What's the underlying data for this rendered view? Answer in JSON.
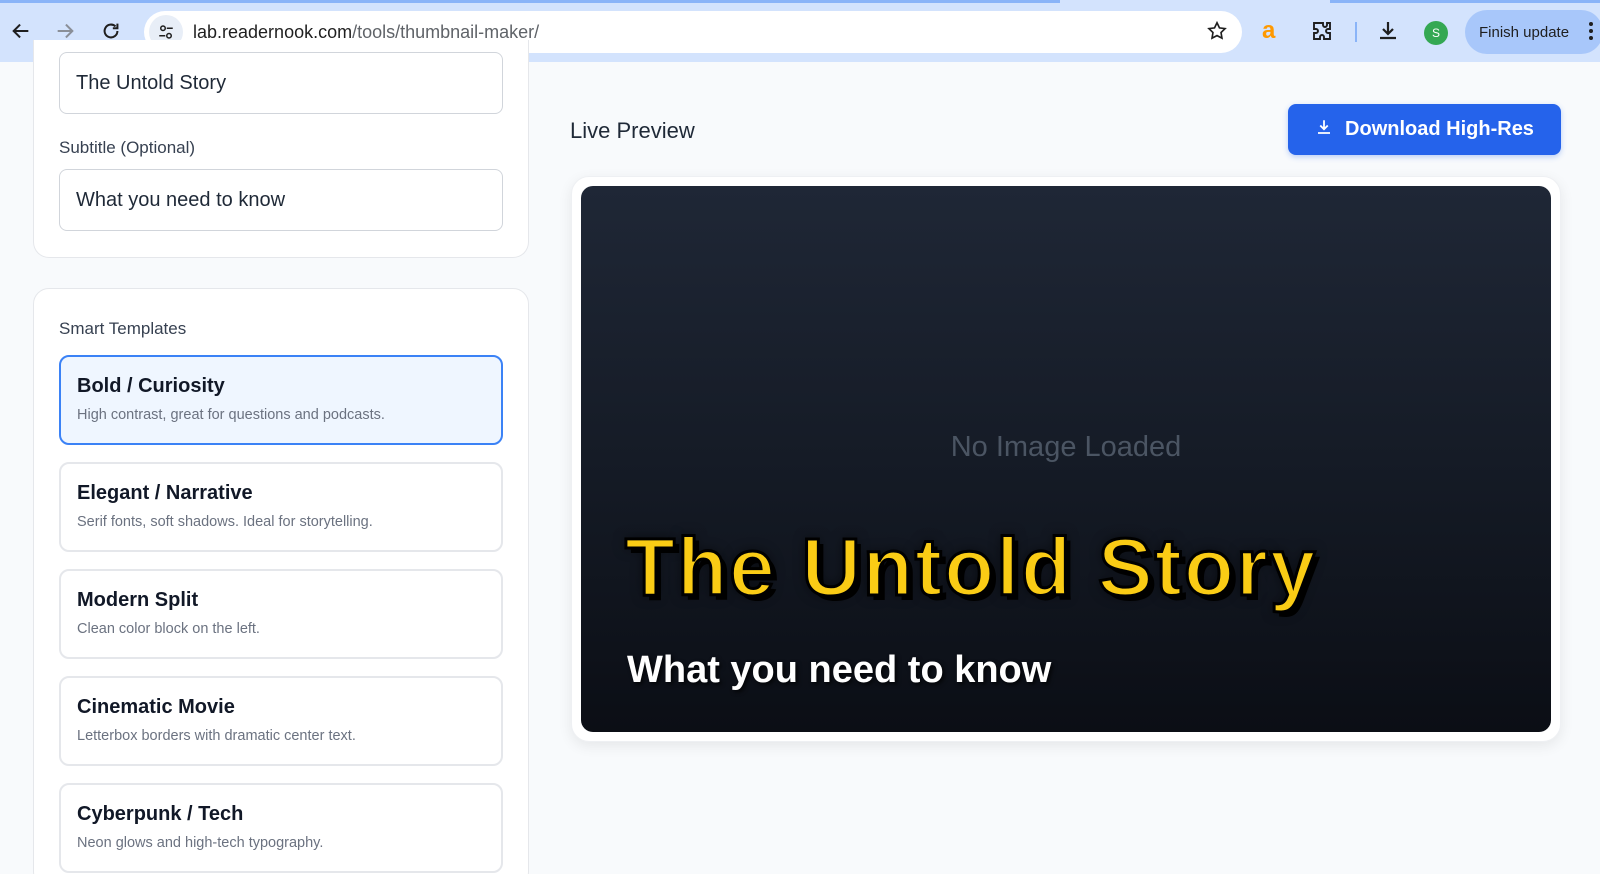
{
  "browser": {
    "url_host": "lab.readernook.com",
    "url_path": "/tools/thumbnail-maker/",
    "avatar_letter": "S",
    "finish_update_label": "Finish update",
    "extension_letter": "a"
  },
  "form": {
    "title_value": "The Untold Story",
    "subtitle_label": "Subtitle (Optional)",
    "subtitle_value": "What you need to know"
  },
  "templates": {
    "heading": "Smart Templates",
    "items": [
      {
        "title": "Bold / Curiosity",
        "desc": "High contrast, great for questions and podcasts."
      },
      {
        "title": "Elegant / Narrative",
        "desc": "Serif fonts, soft shadows. Ideal for storytelling."
      },
      {
        "title": "Modern Split",
        "desc": "Clean color block on the left."
      },
      {
        "title": "Cinematic Movie",
        "desc": "Letterbox borders with dramatic center text."
      },
      {
        "title": "Cyberpunk / Tech",
        "desc": "Neon glows and high-tech typography."
      }
    ]
  },
  "preview": {
    "heading": "Live Preview",
    "download_label": "Download High-Res",
    "no_image_text": "No Image Loaded",
    "thumb_title": "The Untold Story",
    "thumb_subtitle": "What you need to know"
  },
  "colors": {
    "accent": "#2563eb",
    "active_template_border": "#3b82f6",
    "thumb_title": "#facc15"
  }
}
